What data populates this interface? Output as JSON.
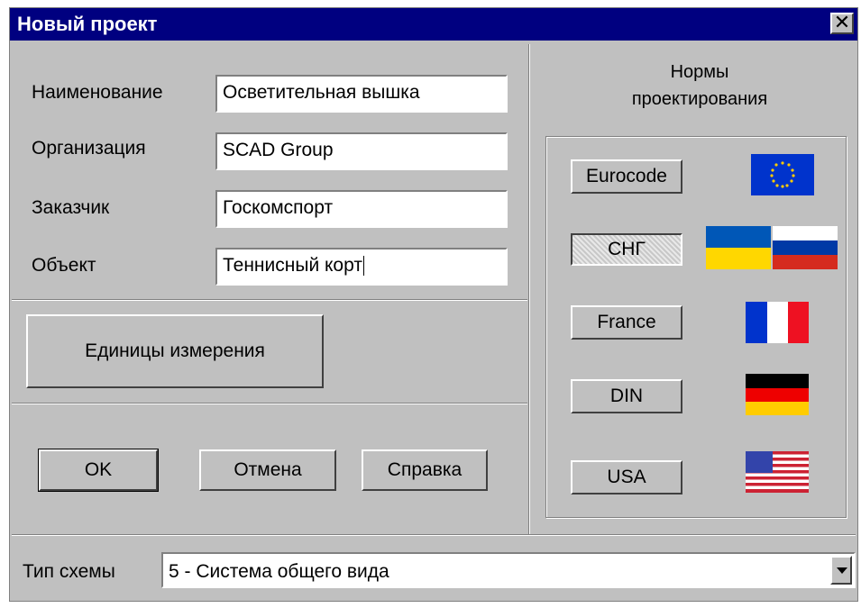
{
  "window": {
    "title": "Новый проект",
    "close_label": "✕"
  },
  "form": {
    "name_label": "Наименование",
    "name_value": "Осветительная вышка",
    "org_label": "Организация",
    "org_value": "SCAD Group",
    "customer_label": "Заказчик",
    "customer_value": "Госкомспорт",
    "object_label": "Объект",
    "object_value": "Теннисный корт"
  },
  "units_button": "Единицы измерения",
  "buttons": {
    "ok": "OK",
    "cancel": "Отмена",
    "help": "Справка"
  },
  "norms": {
    "title_line1": "Нормы",
    "title_line2": "проектирования",
    "items": [
      {
        "label": "Eurocode",
        "flag": "eu-flag-icon",
        "pressed": false
      },
      {
        "label": "СНГ",
        "flag": "ukraine-russia-flags-icon",
        "pressed": true
      },
      {
        "label": "France",
        "flag": "france-flag-icon",
        "pressed": false
      },
      {
        "label": "DIN",
        "flag": "germany-flag-icon",
        "pressed": false
      },
      {
        "label": "USA",
        "flag": "usa-flag-icon",
        "pressed": false
      }
    ]
  },
  "scheme": {
    "label": "Тип схемы",
    "value": "5  - Система общего вида"
  },
  "colors": {
    "titlebar": "#000080",
    "face": "#c0c0c0"
  }
}
